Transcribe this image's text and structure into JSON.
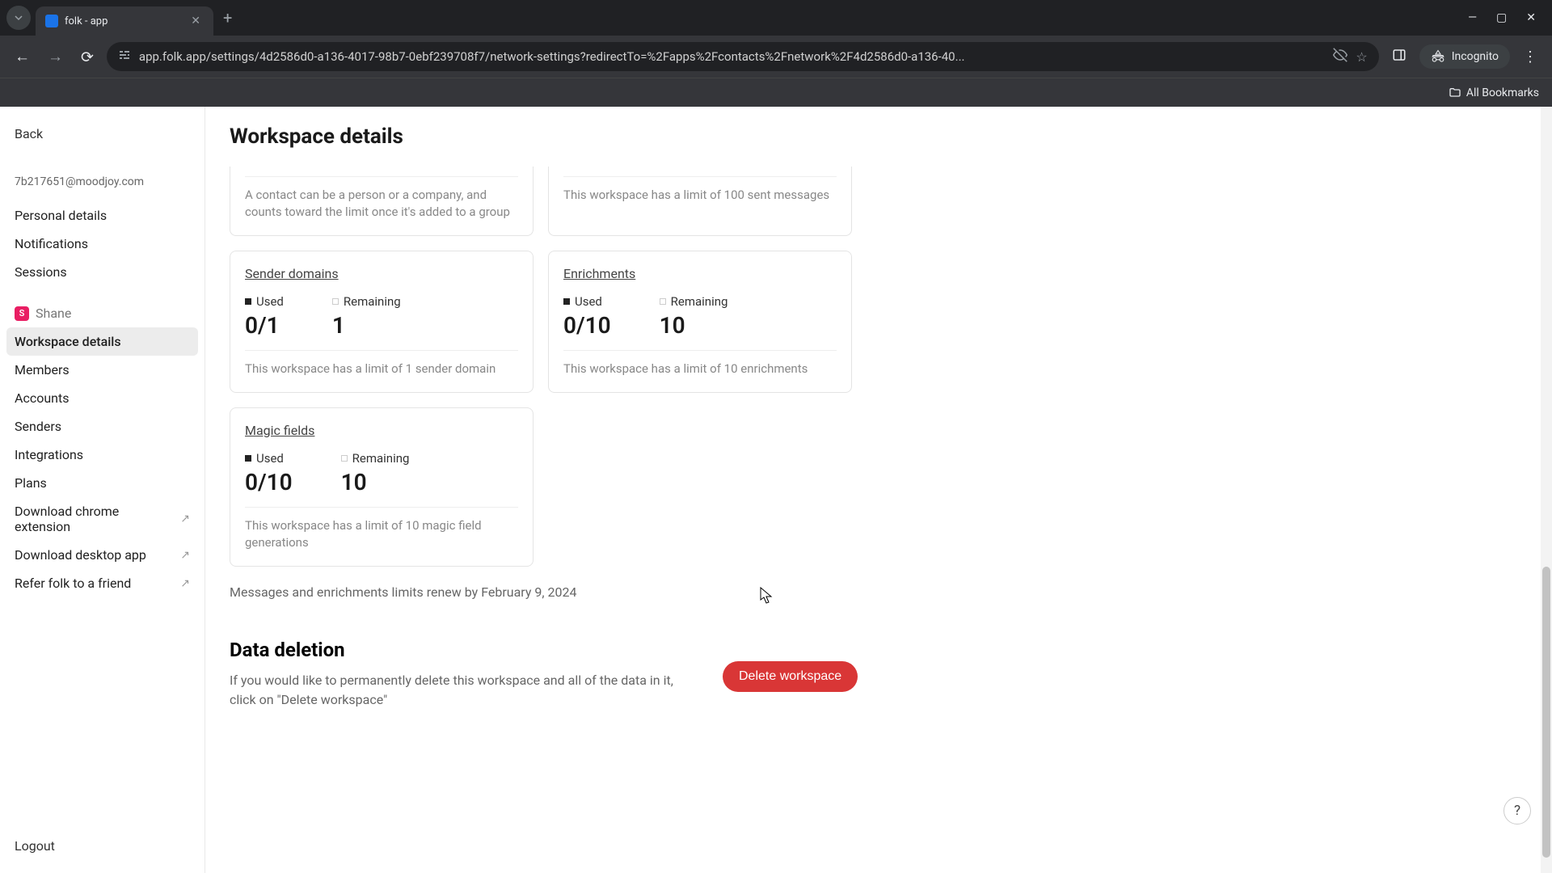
{
  "browser": {
    "tab_title": "folk - app",
    "url": "app.folk.app/settings/4d2586d0-a136-4017-98b7-0ebf239708f7/network-settings?redirectTo=%2Fapps%2Fcontacts%2Fnetwork%2F4d2586d0-a136-40...",
    "incognito": "Incognito",
    "all_bookmarks": "All Bookmarks"
  },
  "sidebar": {
    "back": "Back",
    "email": "7b217651@moodjoy.com",
    "user_section": [
      "Personal details",
      "Notifications",
      "Sessions"
    ],
    "workspace_name": "Shane",
    "workspace_initial": "S",
    "workspace_section": [
      "Workspace details",
      "Members",
      "Accounts",
      "Senders",
      "Integrations",
      "Plans",
      "Download chrome extension",
      "Download desktop app",
      "Refer folk to a friend"
    ],
    "logout": "Logout"
  },
  "page": {
    "title": "Workspace details",
    "partial_contacts_note": "A contact can be a person or a company, and counts toward the limit once it's added to a group",
    "partial_messages_note": "This workspace has a limit of 100 sent messages",
    "cards": {
      "sender_domains": {
        "title": "Sender domains",
        "used_label": "Used",
        "used_value": "0/1",
        "remaining_label": "Remaining",
        "remaining_value": "1",
        "note": "This workspace has a limit of 1 sender domain"
      },
      "enrichments": {
        "title": "Enrichments",
        "used_label": "Used",
        "used_value": "0/10",
        "remaining_label": "Remaining",
        "remaining_value": "10",
        "note": "This workspace has a limit of 10 enrichments"
      },
      "magic_fields": {
        "title": "Magic fields",
        "used_label": "Used",
        "used_value": "0/10",
        "remaining_label": "Remaining",
        "remaining_value": "10",
        "note": "This workspace has a limit of 10 magic field generations"
      }
    },
    "renew_note": "Messages and enrichments limits renew by February 9, 2024",
    "deletion": {
      "title": "Data deletion",
      "body": "If you would like to permanently delete this workspace and all of the data in it, click on \"Delete workspace\"",
      "button": "Delete workspace"
    }
  },
  "help": "?"
}
